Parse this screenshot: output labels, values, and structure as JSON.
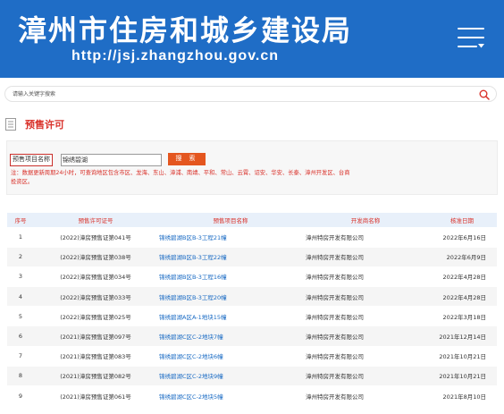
{
  "header": {
    "title": "漳州市住房和城乡建设局",
    "url": "http://jsj.zhangzhou.gov.cn",
    "bg_color": "#1f6dc6",
    "menu_icon": "menu-icon"
  },
  "search": {
    "placeholder": "请输入关键字搜索",
    "icon": "search-icon",
    "icon_color": "#d9312a"
  },
  "section": {
    "title": "预售许可",
    "icon": "document-icon"
  },
  "filter": {
    "label": "预售项目名称",
    "value": "锦绣碧湖",
    "button": "搜 索",
    "note": "注：数据更新周期24小时，可查询地区包含市区、龙海、东山、漳浦、南靖、平和、常山、云霄、诏安、华安、长泰、漳州开发区、台商投资区。"
  },
  "table": {
    "columns": [
      "序号",
      "预售许可证号",
      "预售项目名称",
      "开发商名称",
      "核准日期"
    ],
    "rows": [
      {
        "no": "1",
        "cert": "(2022)漳房预售证第041号",
        "project": "锦绣碧湖B区B-3工程21幢",
        "developer": "漳州特房开发有限公司",
        "date": "2022年6月16日"
      },
      {
        "no": "2",
        "cert": "(2022)漳房预售证第038号",
        "project": "锦绣碧湖B区B-3工程22幢",
        "developer": "漳州特房开发有限公司",
        "date": "2022年6月9日"
      },
      {
        "no": "3",
        "cert": "(2022)漳房预售证第034号",
        "project": "锦绣碧湖B区B-3工程16幢",
        "developer": "漳州特房开发有限公司",
        "date": "2022年4月28日"
      },
      {
        "no": "4",
        "cert": "(2022)漳房预售证第033号",
        "project": "锦绣碧湖B区B-3工程20幢",
        "developer": "漳州特房开发有限公司",
        "date": "2022年4月28日"
      },
      {
        "no": "5",
        "cert": "(2022)漳房预售证第025号",
        "project": "锦绣碧湖A区A-1地块15幢",
        "developer": "漳州特房开发有限公司",
        "date": "2022年3月18日"
      },
      {
        "no": "6",
        "cert": "(2021)漳房预售证第097号",
        "project": "锦绣碧湖C区C-2地块7幢",
        "developer": "漳州特房开发有限公司",
        "date": "2021年12月14日"
      },
      {
        "no": "7",
        "cert": "(2021)漳房预售证第083号",
        "project": "锦绣碧湖C区C-2地块6幢",
        "developer": "漳州特房开发有限公司",
        "date": "2021年10月21日"
      },
      {
        "no": "8",
        "cert": "(2021)漳房预售证第082号",
        "project": "锦绣碧湖C区C-2地块9幢",
        "developer": "漳州特房开发有限公司",
        "date": "2021年10月21日"
      },
      {
        "no": "9",
        "cert": "(2021)漳房预售证第061号",
        "project": "锦绣碧湖C区C-2地块5幢",
        "developer": "漳州特房开发有限公司",
        "date": "2021年8月10日"
      }
    ]
  }
}
